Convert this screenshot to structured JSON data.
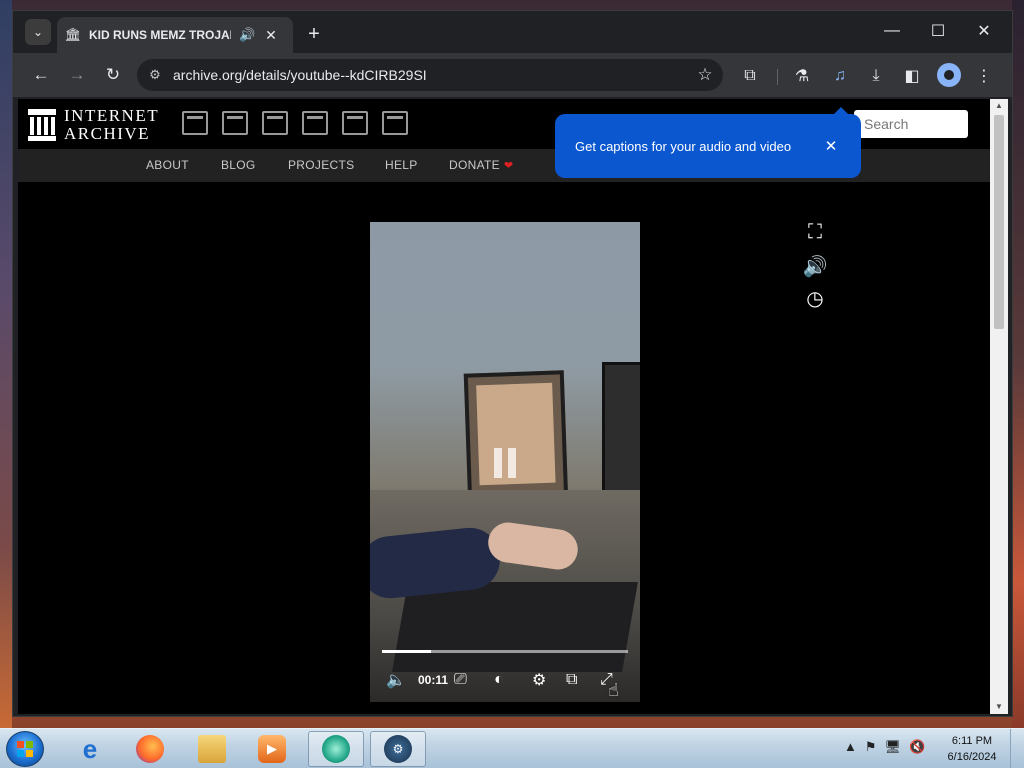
{
  "tab": {
    "title": "KID RUNS MEMZ TROJAN",
    "favicon": "internet-archive-icon",
    "audio_icon": "speaker-icon",
    "close_glyph": "✕"
  },
  "window_controls": {
    "minimize": "—",
    "maximize": "☐",
    "close": "✕",
    "new_tab": "+"
  },
  "toolbar": {
    "back": "←",
    "forward": "→",
    "reload": "↻",
    "url": "archive.org/details/youtube--kdCIRB29SI",
    "site_info_glyph": "⚙",
    "bookmark_glyph": "☆",
    "icons": [
      "extensions-icon",
      "labs-icon",
      "media-controls-icon",
      "downloads-icon",
      "side-panel-icon",
      "profile-icon",
      "menu-icon"
    ]
  },
  "ia": {
    "logo_line1": "INTERNET",
    "logo_line2": "ARCHIVE",
    "search_placeholder": "Search",
    "nav": [
      "ABOUT",
      "BLOG",
      "PROJECTS",
      "HELP",
      "DONATE"
    ],
    "media_types": [
      "web-icon",
      "texts-icon",
      "video-icon",
      "audio-icon",
      "software-icon",
      "images-icon"
    ]
  },
  "tooltip": {
    "text": "Get captions for your audio and video",
    "close_glyph": "✕"
  },
  "player": {
    "time": "00:11",
    "progress_fraction": 0.2,
    "state": "paused"
  },
  "taskbar": {
    "apps": [
      "internet-explorer-icon",
      "firefox-icon",
      "file-explorer-icon",
      "media-player-icon",
      "chrome-canary-icon",
      "steam-icon"
    ],
    "time": "6:11 PM",
    "date": "6/16/2024"
  }
}
